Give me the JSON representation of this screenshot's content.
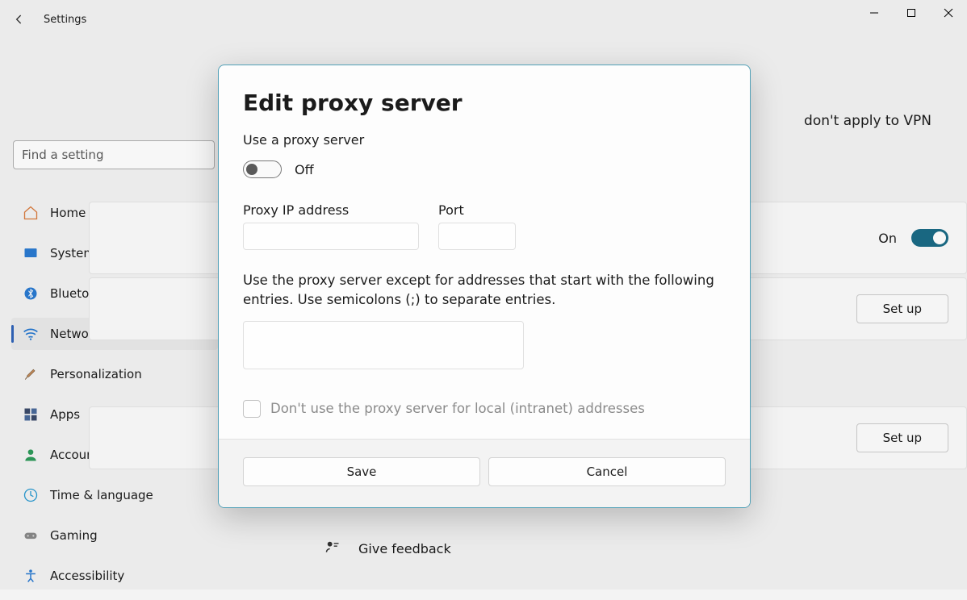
{
  "window": {
    "title": "Settings"
  },
  "search": {
    "placeholder": "Find a setting"
  },
  "sidebar": {
    "items": [
      {
        "label": "Home"
      },
      {
        "label": "System"
      },
      {
        "label": "Bluetooth & devices"
      },
      {
        "label": "Network & internet"
      },
      {
        "label": "Personalization"
      },
      {
        "label": "Apps"
      },
      {
        "label": "Accounts"
      },
      {
        "label": "Time & language"
      },
      {
        "label": "Gaming"
      },
      {
        "label": "Accessibility"
      }
    ]
  },
  "content": {
    "truncated_notice": "don't apply to VPN",
    "auto_on_label": "On",
    "setup_btn": "Set up",
    "feedback": "Give feedback"
  },
  "dialog": {
    "title": "Edit proxy server",
    "use_proxy_label": "Use a proxy server",
    "toggle_state": "Off",
    "ip_label": "Proxy IP address",
    "ip_value": "",
    "port_label": "Port",
    "port_value": "",
    "except_label": "Use the proxy server except for addresses that start with the following entries. Use semicolons (;) to separate entries.",
    "except_value": "",
    "local_checkbox_label": "Don't use the proxy server for local (intranet) addresses",
    "save_btn": "Save",
    "cancel_btn": "Cancel"
  }
}
